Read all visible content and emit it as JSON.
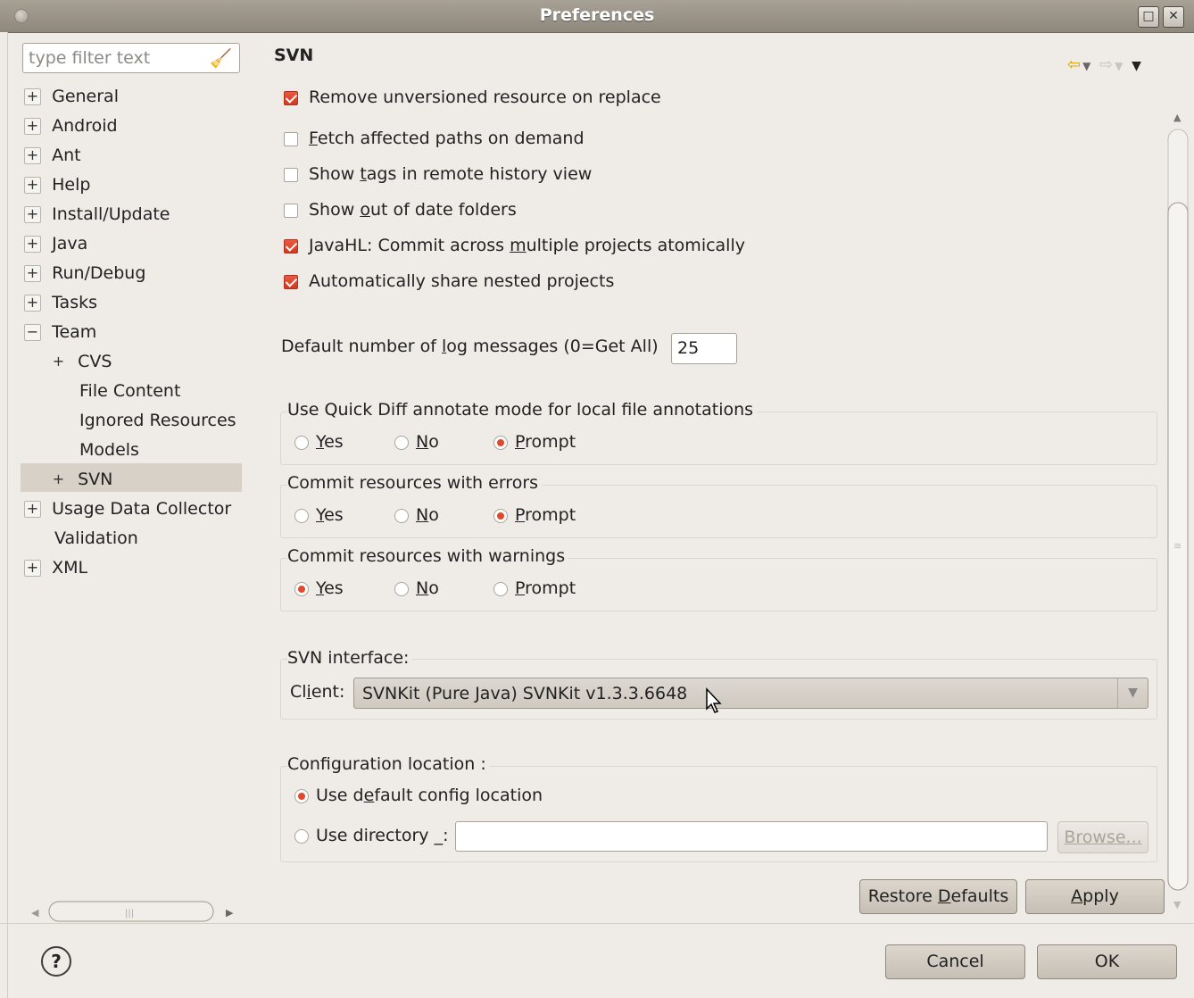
{
  "window": {
    "title": "Preferences"
  },
  "filter": {
    "placeholder": "type filter text"
  },
  "tree": [
    {
      "label": "General",
      "expander": "+"
    },
    {
      "label": "Android",
      "expander": "+"
    },
    {
      "label": "Ant",
      "expander": "+"
    },
    {
      "label": "Help",
      "expander": "+"
    },
    {
      "label": "Install/Update",
      "expander": "+"
    },
    {
      "label": "Java",
      "expander": "+"
    },
    {
      "label": "Run/Debug",
      "expander": "+"
    },
    {
      "label": "Tasks",
      "expander": "+"
    },
    {
      "label": "Team",
      "expander": "−"
    },
    {
      "label": "CVS",
      "expander": "+"
    },
    {
      "label": "File Content",
      "expander": ""
    },
    {
      "label": "Ignored Resources",
      "expander": ""
    },
    {
      "label": "Models",
      "expander": ""
    },
    {
      "label": "SVN",
      "expander": "+"
    },
    {
      "label": "Usage Data Collector",
      "expander": "+"
    },
    {
      "label": "Validation",
      "expander": ""
    },
    {
      "label": "XML",
      "expander": "+"
    }
  ],
  "page": {
    "title": "SVN"
  },
  "checks": {
    "remove_unversioned": "Remove unversioned resource on replace",
    "fetch_paths_pre": "",
    "fetch_paths_u": "F",
    "fetch_paths_post": "etch affected paths on demand",
    "show_tags_pre": "Show ",
    "show_tags_u": "t",
    "show_tags_post": "ags in remote history view",
    "out_of_date_pre": "Show ",
    "out_of_date_u": "o",
    "out_of_date_post": "ut of date folders",
    "javahl_pre": "JavaHL: Commit across ",
    "javahl_u": "m",
    "javahl_post": "ultiple projects atomically",
    "share_nested": "Automatically share nested projects"
  },
  "log": {
    "label_pre": "Default number of ",
    "label_u": "l",
    "label_post": "og messages (0=Get All)",
    "value": "25"
  },
  "groups": {
    "quick_diff": "Use Quick Diff annotate mode for local file annotations",
    "commit_errors": "Commit resources with errors",
    "commit_warnings": "Commit resources with warnings",
    "svn_interface": "SVN interface:",
    "config_location": "Configuration location :"
  },
  "radio": {
    "yes_u": "Y",
    "yes_rest": "es",
    "no_u": "N",
    "no_rest": "o",
    "prompt_u": "P",
    "prompt_rest": "rompt"
  },
  "client": {
    "label_pre": "Cl",
    "label_u": "i",
    "label_post": "ent:",
    "value": "SVNKit (Pure Java) SVNKit v1.3.3.6648"
  },
  "config": {
    "default_pre": "Use d",
    "default_u": "e",
    "default_post": "fault config location",
    "directory_pre": "Use directory ",
    "directory_u": "_",
    "directory_post": ":",
    "browse": "Browse..."
  },
  "buttons": {
    "restore_pre": "Restore ",
    "restore_u": "D",
    "restore_post": "efaults",
    "apply_u": "A",
    "apply_post": "pply",
    "cancel": "Cancel",
    "ok": "OK"
  }
}
